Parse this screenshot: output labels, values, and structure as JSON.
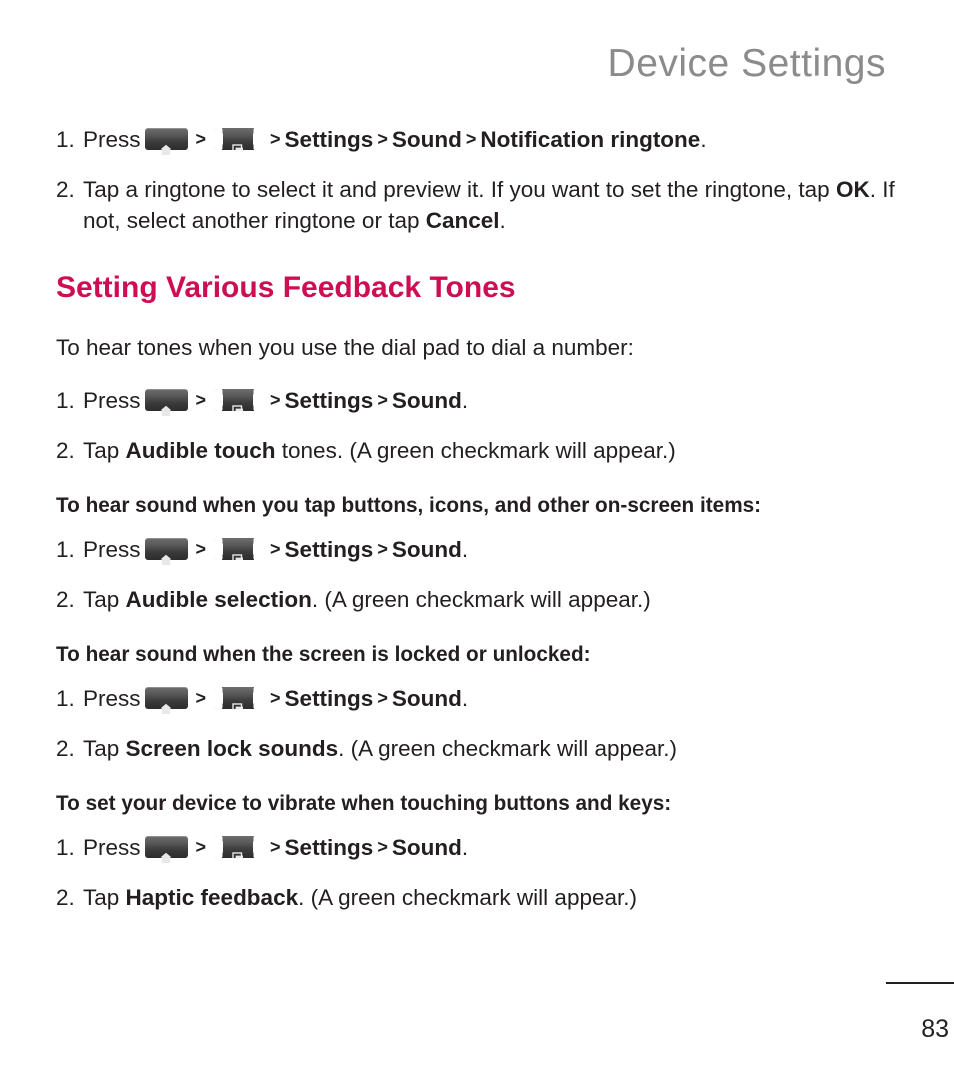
{
  "header": {
    "title": "Device Settings",
    "color": "#8b8b8b"
  },
  "icons": {
    "home": "home-key-icon",
    "menu": "menu-key-icon",
    "separator": ">"
  },
  "blocks": {
    "step1": {
      "number": "1.",
      "press_label": "Press",
      "sep1": ">",
      "sep2": ">",
      "settings": "Settings",
      "sep3": ">",
      "sound": "Sound",
      "sep4": ">",
      "target": "Notification ringtone",
      "period": "."
    },
    "step2": {
      "number": "2.",
      "part1": "Tap a ringtone to select it and preview it. If you want to set the ringtone, tap ",
      "ok": "OK",
      "part2": ". If not, select another ringtone or tap ",
      "cancel": "Cancel",
      "part3": "."
    },
    "section_heading": "Setting Various Feedback Tones",
    "intro": "To hear tones when you use the dial pad to dial a number:",
    "group1": {
      "step1": {
        "number": "1.",
        "press_label": "Press",
        "sep1": ">",
        "sep2": ">",
        "settings": "Settings",
        "sep3": ">",
        "sound": "Sound",
        "period": "."
      },
      "step2": {
        "number": "2.",
        "prefix": "Tap ",
        "bold": "Audible touch",
        "suffix": " tones. (A green checkmark will appear.)"
      }
    },
    "subhead2": "To hear sound when you tap buttons, icons, and other on-screen items:",
    "group2": {
      "step1": {
        "number": "1.",
        "press_label": "Press",
        "sep1": ">",
        "sep2": ">",
        "settings": "Settings",
        "sep3": ">",
        "sound": "Sound",
        "period": "."
      },
      "step2": {
        "number": "2.",
        "prefix": "Tap ",
        "bold": "Audible selection",
        "suffix": ". (A green checkmark will appear.)"
      }
    },
    "subhead3": "To hear sound when the screen is locked or unlocked:",
    "group3": {
      "step1": {
        "number": "1.",
        "press_label": "Press",
        "sep1": ">",
        "sep2": ">",
        "settings": "Settings",
        "sep3": ">",
        "sound": "Sound",
        "period": "."
      },
      "step2": {
        "number": "2.",
        "prefix": "Tap ",
        "bold": "Screen lock sounds",
        "suffix": ". (A green checkmark will appear.)"
      }
    },
    "subhead4": "To set your device to vibrate when touching buttons and keys:",
    "group4": {
      "step1": {
        "number": "1.",
        "press_label": "Press",
        "sep1": ">",
        "sep2": ">",
        "settings": "Settings",
        "sep3": ">",
        "sound": "Sound",
        "period": "."
      },
      "step2": {
        "number": "2.",
        "prefix": "Tap ",
        "bold": "Haptic feedback",
        "suffix": ". (A green checkmark will appear.)"
      }
    }
  },
  "footer": {
    "page_number": "83"
  }
}
